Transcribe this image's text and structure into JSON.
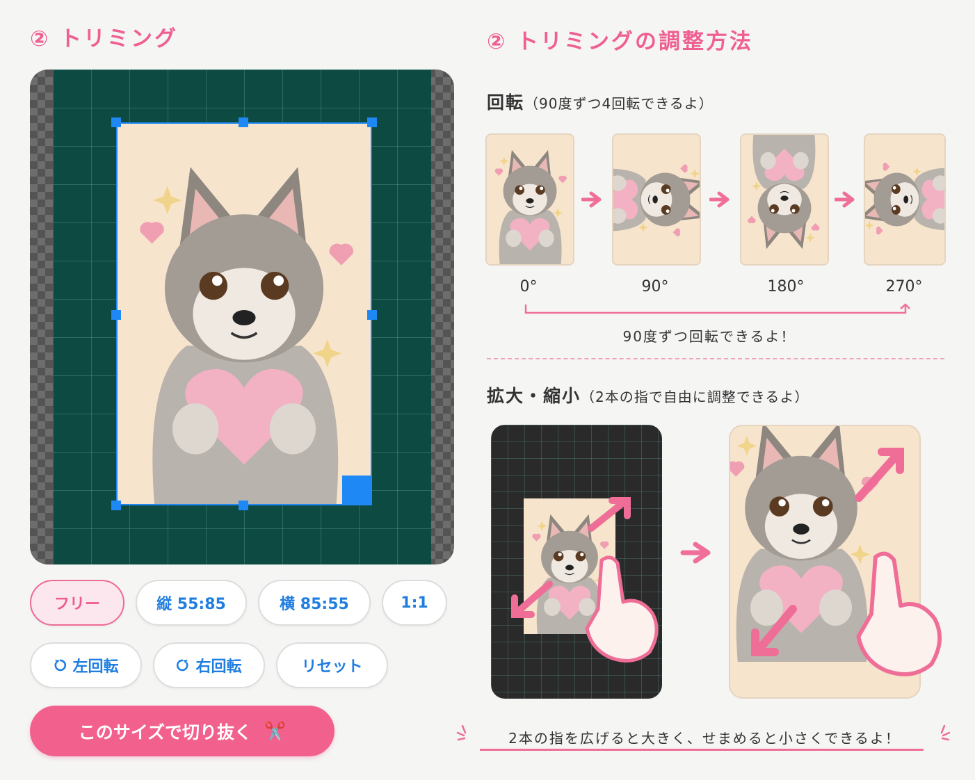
{
  "left_title": "② トリミング",
  "right_title": "② トリミングの調整方法",
  "ratio_buttons": [
    {
      "label": "フリー",
      "active": true
    },
    {
      "label": "縦 55:85"
    },
    {
      "label": "横 85:55"
    },
    {
      "label": "1:1"
    }
  ],
  "action_buttons": {
    "rotate_left": "左回転",
    "rotate_right": "右回転",
    "reset": "リセット"
  },
  "crop_button": {
    "label": "このサイズで切り抜く",
    "icon": "scissors-icon",
    "glyph": "✂️"
  },
  "rotation": {
    "heading": "回転",
    "heading_note": "（90度ずつ4回転できるよ）",
    "steps": [
      "0°",
      "90°",
      "180°",
      "270°"
    ],
    "caption": "90度ずつ回転できるよ！"
  },
  "zoom": {
    "heading": "拡大・縮小",
    "heading_note": "（2本の指で自由に調整できるよ）",
    "caption": "2本の指を広げると大きく、せまめると小さくできるよ！"
  },
  "colors": {
    "accent_pink": "#f2608e",
    "selection_blue": "#1e88f5",
    "crop_bg": "#0d4a42"
  }
}
